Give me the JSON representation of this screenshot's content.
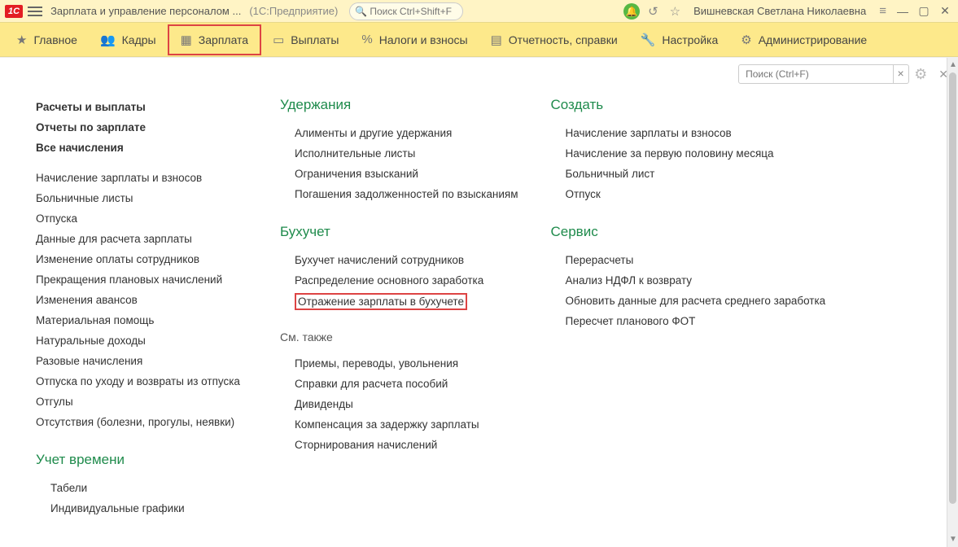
{
  "titlebar": {
    "logo": "1C",
    "app_title": "Зарплата и управление персоналом ...",
    "app_sub": "(1С:Предприятие)",
    "search_placeholder": "Поиск Ctrl+Shift+F",
    "user": "Вишневская Светлана Николаевна"
  },
  "menubar": {
    "items": [
      {
        "label": "Главное"
      },
      {
        "label": "Кадры"
      },
      {
        "label": "Зарплата"
      },
      {
        "label": "Выплаты"
      },
      {
        "label": "Налоги и взносы"
      },
      {
        "label": "Отчетность, справки"
      },
      {
        "label": "Настройка"
      },
      {
        "label": "Администрирование"
      }
    ]
  },
  "toolbar": {
    "search_placeholder": "Поиск (Ctrl+F)"
  },
  "col1": {
    "top": [
      "Расчеты и выплаты",
      "Отчеты по зарплате",
      "Все начисления"
    ],
    "items": [
      "Начисление зарплаты и взносов",
      "Больничные листы",
      "Отпуска",
      "Данные для расчета зарплаты",
      "Изменение оплаты сотрудников",
      "Прекращения плановых начислений",
      "Изменения авансов",
      "Материальная помощь",
      "Натуральные доходы",
      "Разовые начисления",
      "Отпуска по уходу и возвраты из отпуска",
      "Отгулы",
      "Отсутствия (болезни, прогулы, неявки)"
    ],
    "group2": "Учет времени",
    "items2": [
      "Табели",
      "Индивидуальные графики"
    ]
  },
  "col2": {
    "g1": "Удержания",
    "g1_items": [
      "Алименты и другие удержания",
      "Исполнительные листы",
      "Ограничения взысканий",
      "Погашения задолженностей по взысканиям"
    ],
    "g2": "Бухучет",
    "g2_items": [
      "Бухучет начислений сотрудников",
      "Распределение основного заработка",
      "Отражение зарплаты в бухучете"
    ],
    "g3": "См. также",
    "g3_items": [
      "Приемы, переводы, увольнения",
      "Справки для расчета пособий",
      "Дивиденды",
      "Компенсация за задержку зарплаты",
      "Сторнирования начислений"
    ]
  },
  "col3": {
    "g1": "Создать",
    "g1_items": [
      "Начисление зарплаты и взносов",
      "Начисление за первую половину месяца",
      "Больничный лист",
      "Отпуск"
    ],
    "g2": "Сервис",
    "g2_items": [
      "Перерасчеты",
      "Анализ НДФЛ к возврату",
      "Обновить данные для расчета среднего заработка",
      "Пересчет планового ФОТ"
    ]
  }
}
